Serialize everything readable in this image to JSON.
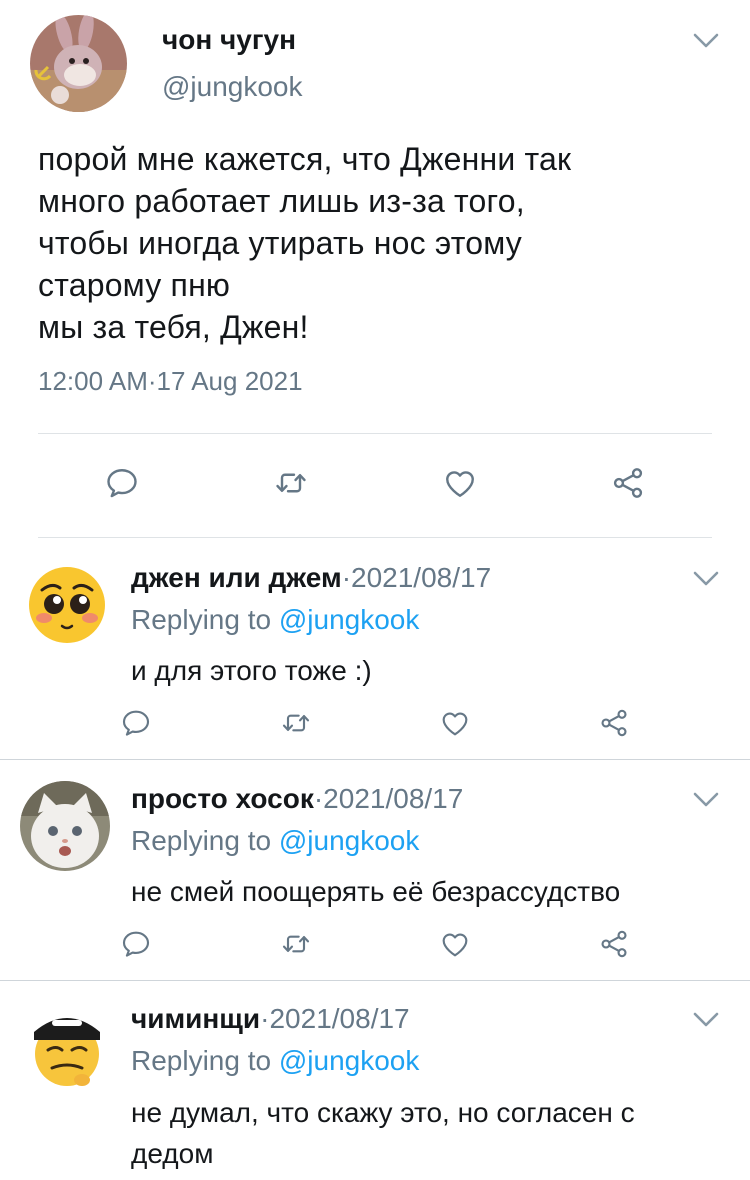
{
  "main_tweet": {
    "author_name": "чон чугун",
    "handle": "@jungkook",
    "text_lines": [
      "порой мне кажется, что Дженни так",
      "много работает лишь из-за того,",
      "чтобы иногда утирать нос этому",
      "старому пню",
      "мы за тебя, Джен!"
    ],
    "timestamp": "12:00 AM·17 Aug 2021",
    "actions": [
      "reply-icon",
      "retweet-icon",
      "like-icon",
      "share-icon"
    ]
  },
  "replies": [
    {
      "author_name": "джен или джем",
      "date": "·2021/08/17",
      "replying_prefix": "Replying to ",
      "replying_handle": "@jungkook",
      "text_lines": [
        "и для этого тоже :)"
      ]
    },
    {
      "author_name": "просто хосок",
      "date": "·2021/08/17",
      "replying_prefix": "Replying to ",
      "replying_handle": "@jungkook",
      "text_lines": [
        "не смей поощерять её безрассудство"
      ]
    },
    {
      "author_name": "чиминщи",
      "date": "·2021/08/17",
      "replying_prefix": "Replying to ",
      "replying_handle": "@jungkook",
      "text_lines": [
        "не думал, что скажу это, но согласен с",
        "дедом"
      ]
    }
  ],
  "colors": {
    "text": "#14171a",
    "secondary": "#657786",
    "mention": "#1da1f2",
    "icon": "#657786"
  }
}
